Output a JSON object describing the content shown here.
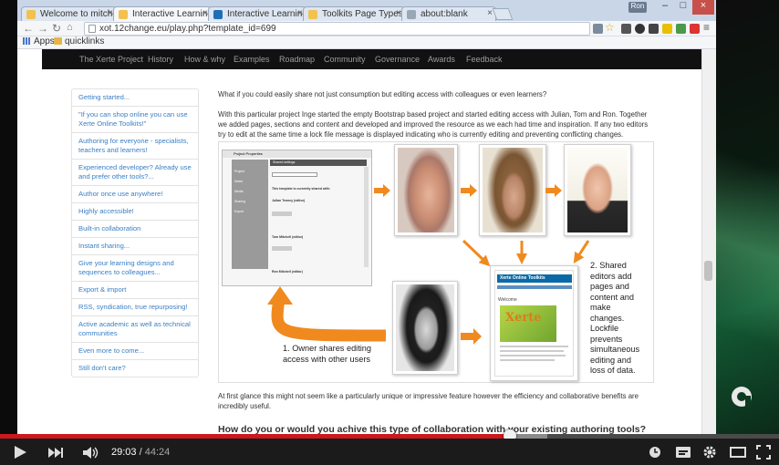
{
  "browser": {
    "tabs": [
      {
        "label": "Welcome to mitchell",
        "color": "#f2c14e"
      },
      {
        "label": "Interactive Learning",
        "color": "#f2c14e"
      },
      {
        "label": "Interactive Learning",
        "color": "#1f6fb5"
      },
      {
        "label": "Toolkits Page Types",
        "color": "#f2c14e"
      },
      {
        "label": "about:blank",
        "color": "#9aa7b6"
      }
    ],
    "active_tab": 1,
    "user_badge": "Ron",
    "url": "xot.12change.eu/play.php?template_id=699",
    "bookmarks": [
      "Apps",
      "quicklinks"
    ]
  },
  "site": {
    "nav": [
      "The Xerte Project",
      "History",
      "How & why",
      "Examples",
      "Roadmap",
      "Community",
      "Governance",
      "Awards",
      "Feedback"
    ],
    "sidebar": [
      "Getting started...",
      "\"If you can shop online you can use Xerte Online Toolkits!\"",
      "Authoring for everyone - specialists, teachers and learners!",
      "Experienced developer? Already use and prefer other tools?...",
      "Author once use anywhere!",
      "Highly accessible!",
      "Built-in collaboration",
      "Instant sharing...",
      "Give your learning designs and sequences to colleagues...",
      "Export & import",
      "RSS, syndication, true repurposing!",
      "Active academic as well as technical communities",
      "Even more to come...",
      "Still don't care?"
    ],
    "intro": "What if you could easily share not just consumption but editing access with colleagues or even learners?",
    "para1": "With this particular project Inge started the empty Bootstrap based project and started editing access with Julian, Tom and Ron. Together we added pages, sections and content and developed and improved the resource as we each had time and inspiration. If any two editors try to edit at the same time a lock file message is displayed indicating who is currently editing and preventing conflicting changes.",
    "diagram": {
      "caption1": "1. Owner shares editing access with other users",
      "caption2": "2. Shared editors add pages and content and make changes. Lockfile prevents simultaneous editing and loss of data.",
      "mini_title": "Xerte Online Toolkits",
      "mini_welcome": "Welcome",
      "mini_brand": "Xerte",
      "form_title": "Project Properties",
      "form_heading": "Shared settings",
      "form_rows": [
        "Project",
        "Notes",
        "Media",
        "Sharing",
        "",
        "Export"
      ],
      "form_note": "This template is currently shared with:",
      "form_names": [
        "Julian Tenney (editor)",
        "Tom Mitchell (editor)",
        "Ron Mitchell (editor)"
      ]
    },
    "para2": "At first glance this might not seem like a particularly unique or impressive feature however the efficiency and collaborative benefits are incredibly useful.",
    "heading2": "How do you or would you achive this type of collaboration with your existing authoring tools?"
  },
  "player": {
    "current_time": "29:03",
    "duration": "44:24",
    "progress_fraction": 0.654,
    "accent": "#cc181e"
  }
}
